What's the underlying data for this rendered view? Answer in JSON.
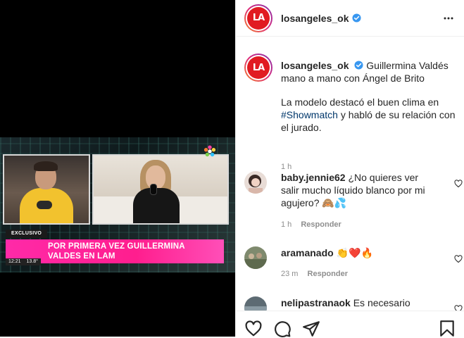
{
  "post": {
    "video": {
      "badge": "EXCLUSIVO",
      "headline_line1": "POR PRIMERA VEZ GUILLERMINA",
      "headline_line2": "VALDES EN LAM",
      "ticker_time": "12:21",
      "ticker_temp": "13.8°"
    },
    "header": {
      "username": "losangeles_ok",
      "avatar_text": "LA",
      "verified_icon": "verified-badge-icon",
      "more_icon": "more-options-icon"
    },
    "caption": {
      "username": "losangeles_ok",
      "text_line1": "Guillermina Valdés mano a mano con Ángel de Brito",
      "text_before_hashtag": "La modelo destacó el buen clima en ",
      "hashtag": "#Showmatch",
      "text_after_hashtag": " y habló de su relación con el jurado.",
      "time": "1 h"
    },
    "comments": [
      {
        "username": "baby.jennie62",
        "text": "¿No quieres ver salir mucho líquido blanco por mi agujero? 🙈💦",
        "time": "1 h",
        "reply": "Responder"
      },
      {
        "username": "aramanado",
        "text": "👏❤️🔥",
        "time": "23 m",
        "reply": "Responder"
      },
      {
        "username": "nelipastranaok",
        "text": "Es necesario"
      }
    ],
    "actions": [
      "like-icon",
      "comment-icon",
      "share-icon",
      "save-icon"
    ],
    "colors": {
      "accent_pink": "#ff1e8e",
      "brand_red": "#e11b22",
      "link_blue": "#00376b",
      "meta_gray": "#8e8e8e"
    }
  }
}
